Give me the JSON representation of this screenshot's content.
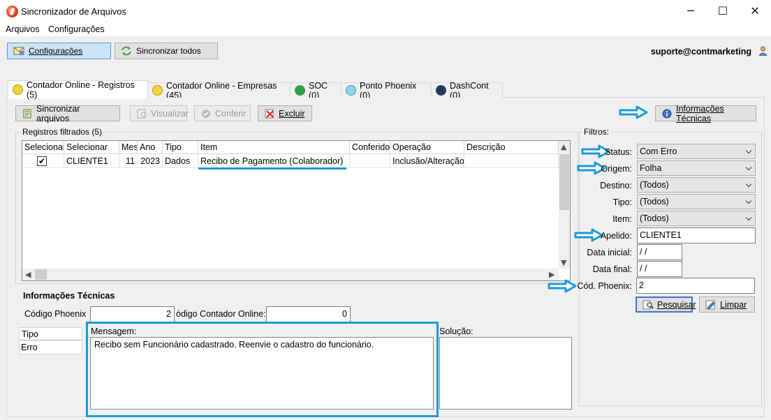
{
  "window": {
    "title": "Sincronizador de Arquivos",
    "minimize": "─",
    "maximize": "☐",
    "close": "✕"
  },
  "menu": [
    "Arquivos",
    "Configurações"
  ],
  "toolbar": {
    "config_label": "Configurações",
    "sync_all_label": "Sincronizar todos",
    "user": "suporte@contmarketing"
  },
  "tabs": [
    {
      "label": "Contador Online - Registros (5)",
      "icon": "smiley-icon"
    },
    {
      "label": "Contador Online - Empresas (45)",
      "icon": "smiley-icon"
    },
    {
      "label": "SOC (0)",
      "icon": "soc-icon"
    },
    {
      "label": "Ponto Phoenix (0)",
      "icon": "phoenix-icon"
    },
    {
      "label": "DashCont (0)",
      "icon": "dashcont-icon"
    }
  ],
  "actions": {
    "sync_files": "Sincronizar arquivos",
    "view": "Visualizar",
    "check": "Conferir",
    "delete": "Excluir",
    "tech_info": "Informações Técnicas"
  },
  "records": {
    "group_title": "Registros filtrados (5)",
    "columns": [
      "Selecionar",
      "Selecionar",
      "Mes",
      "Ano",
      "Tipo",
      "Item",
      "Conferido",
      "Operação",
      "Descrição"
    ],
    "rows": [
      {
        "checked": true,
        "selecionar": "CLIENTE1",
        "mes": "11",
        "ano": "2023",
        "tipo": "Dados",
        "item": "Recibo de Pagamento (Colaborador)",
        "conferido": "",
        "operacao": "Inclusão/Alteração",
        "descricao": ""
      }
    ]
  },
  "tech_info": {
    "title": "Informações Técnicas",
    "codigo_phoenix_label": "Código Phoenix",
    "codigo_phoenix_value": "2",
    "codigo_contador_label": "ódigo Contador Online:",
    "codigo_contador_value": "0",
    "tipo_header": "Tipo",
    "tipo_value": "Erro",
    "mensagem_label": "Mensagem:",
    "mensagem_text": "Recibo sem Funcionário cadastrado. Reenvie o cadastro do funcionário.",
    "solucao_label": "Solução:"
  },
  "filters": {
    "title": "Filtros:",
    "status_label": "Status:",
    "status_value": "Com Erro",
    "origem_label": "Origem:",
    "origem_value": "Folha",
    "destino_label": "Destino:",
    "destino_value": "(Todos)",
    "tipo_label": "Tipo:",
    "tipo_value": "(Todos)",
    "item_label": "Item:",
    "item_value": "(Todos)",
    "apelido_label": "Apelido:",
    "apelido_value": "CLIENTE1",
    "data_inicial_label": "Data inicial:",
    "data_inicial_value": " /  /",
    "data_final_label": "Data final:",
    "data_final_value": " /  /",
    "cod_phoenix_label": "Cód. Phoenix:",
    "cod_phoenix_value": "2",
    "search_label": "Pesquisar",
    "clear_label": "Limpar"
  },
  "colors": {
    "accent": "#1a9ad6",
    "selected_button": "#cce4f7",
    "highlight_border": "#1a9ad6"
  }
}
